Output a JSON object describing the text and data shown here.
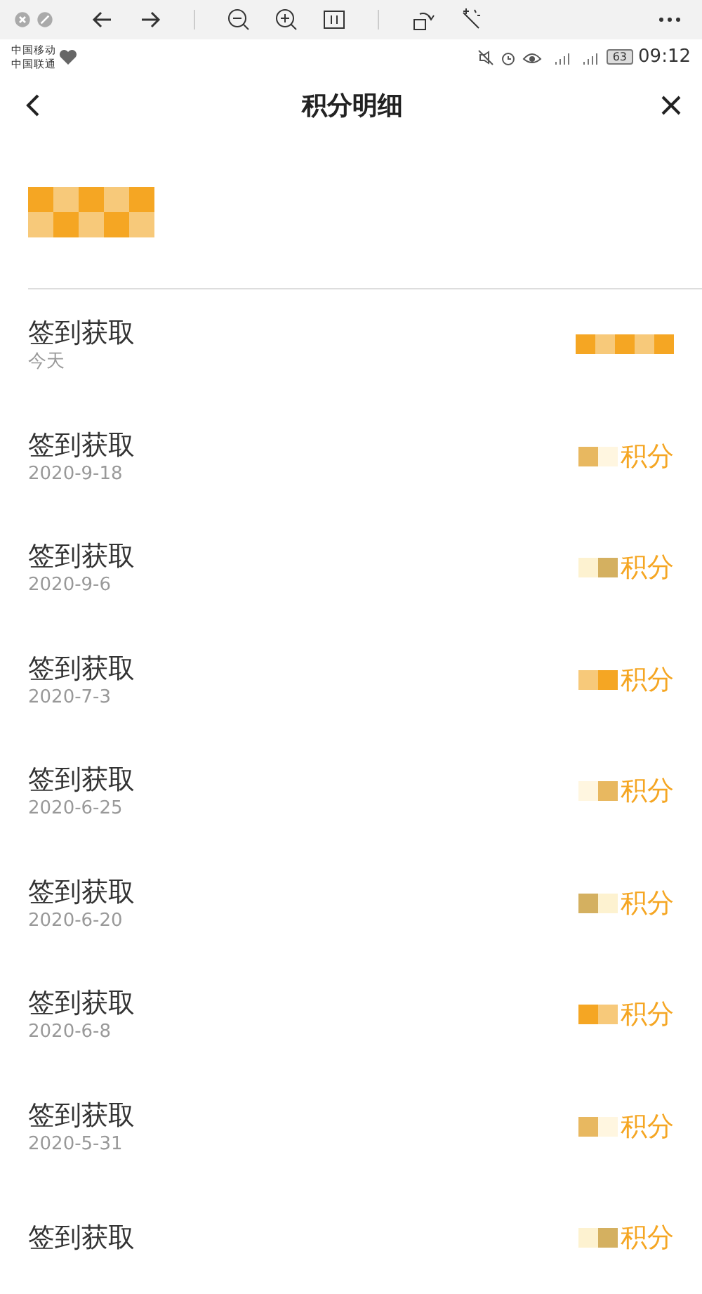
{
  "status_bar": {
    "carriers": [
      "中国移动",
      "中国联通"
    ],
    "battery": "63",
    "time": "09:12"
  },
  "header": {
    "title": "积分明细"
  },
  "records": [
    {
      "title": "签到获取",
      "date": "今天"
    },
    {
      "title": "签到获取",
      "date": "2020-9-18",
      "unit": "积分"
    },
    {
      "title": "签到获取",
      "date": "2020-9-6",
      "unit": "积分"
    },
    {
      "title": "签到获取",
      "date": "2020-7-3",
      "unit": "积分"
    },
    {
      "title": "签到获取",
      "date": "2020-6-25",
      "unit": "积分"
    },
    {
      "title": "签到获取",
      "date": "2020-6-20",
      "unit": "积分"
    },
    {
      "title": "签到获取",
      "date": "2020-6-8",
      "unit": "积分"
    },
    {
      "title": "签到获取",
      "date": "2020-5-31",
      "unit": "积分"
    },
    {
      "title": "签到获取",
      "unit": "积分"
    }
  ]
}
